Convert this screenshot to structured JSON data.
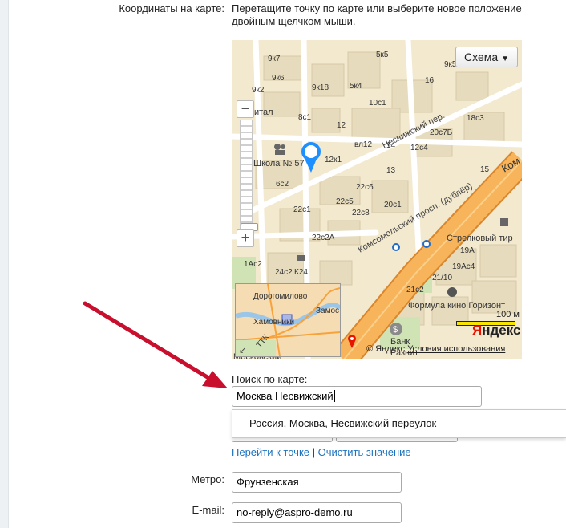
{
  "form": {
    "coords_label": "Координаты на карте:",
    "coords_hint_line1": "Перетащите точку по карте или выберите новое положение",
    "coords_hint_line2": "двойным щелчком мыши.",
    "search_label": "Поиск по карте:",
    "search_value": "Москва Несвижский",
    "suggestion": "Россия, Москва, Несвижский переулок",
    "link_goto": "Перейти к точке",
    "link_separator": "|",
    "link_clear": "Очистить значение",
    "metro_label": "Метро:",
    "metro_value": "Фрунзенская",
    "email_label": "E-mail:",
    "email_value": "no-reply@aspro-demo.ru"
  },
  "map": {
    "schema_button": "Схема",
    "scale_label": "100 м",
    "brand_first": "Я",
    "brand_rest": "ндекс",
    "copyright": "© Яндекс",
    "terms": "Условия использования",
    "labels": {
      "street1": "Несвижский пер.",
      "street2": "Комсомольский просп. (дублёр)",
      "street3": "Ком",
      "school": "Школа № 57",
      "cinema": "Формула кино Горизонт",
      "station": "Стрелковый тир",
      "bank": "Банк",
      "razvit": "Развит",
      "moskov": "Московский",
      "ital": "итал",
      "b1": "9к7",
      "b2": "9к18",
      "b3": "5к4",
      "b4": "5к5",
      "b5": "10с1",
      "b6": "8с1",
      "b7": "12",
      "b8": "9к2",
      "b9": "12к1",
      "b10": "вл12",
      "b11": "12с4",
      "b12": "20с7Б",
      "b13": "18с3",
      "b14": "20с1",
      "b15": "22с6",
      "b16": "22с5",
      "b17": "22с1",
      "b18": "22с8",
      "b19": "22с2А",
      "b20": "24с2",
      "b21": "К24",
      "b22": "1Ас2",
      "b23": "6с2",
      "b24": "19А",
      "b25": "19Ас4",
      "b26": "21/10",
      "b27": "21с2",
      "b28": "16",
      "b29": "9к5",
      "b30": "9к6",
      "b31": "13",
      "b32": "14",
      "b33": "15"
    },
    "minimap": {
      "m1": "Дорогомилово",
      "m2": "Хамовники",
      "m3": "Замос",
      "m4": "ТТК"
    }
  },
  "colors": {
    "link": "#1e73be",
    "road_major": "#f5a623",
    "arrow": "#c8102e",
    "marker": "#1e90ff"
  }
}
